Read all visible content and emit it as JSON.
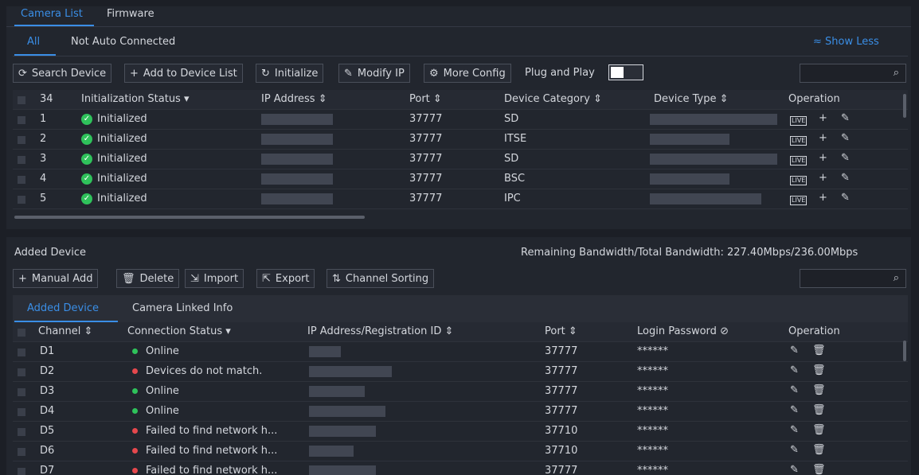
{
  "top_tabs": [
    "Camera List",
    "Firmware"
  ],
  "sub_tabs": [
    "All",
    "Not Auto Connected"
  ],
  "show_less": "Show Less",
  "toolbar": {
    "search_device": "Search Device",
    "add_to_list": "Add to Device List",
    "initialize": "Initialize",
    "modify_ip": "Modify IP",
    "more_config": "More Config",
    "plug_and_play": "Plug and Play"
  },
  "device_table": {
    "count": "34",
    "headers": [
      "Initialization Status",
      "IP Address",
      "Port",
      "Device Category",
      "Device Type",
      "Operation"
    ],
    "rows": [
      {
        "num": "1",
        "status": "Initialized",
        "port": "37777",
        "category": "SD"
      },
      {
        "num": "2",
        "status": "Initialized",
        "port": "37777",
        "category": "ITSE"
      },
      {
        "num": "3",
        "status": "Initialized",
        "port": "37777",
        "category": "SD"
      },
      {
        "num": "4",
        "status": "Initialized",
        "port": "37777",
        "category": "BSC"
      },
      {
        "num": "5",
        "status": "Initialized",
        "port": "37777",
        "category": "IPC"
      }
    ]
  },
  "added": {
    "title": "Added Device",
    "bandwidth_label": "Remaining Bandwidth/Total Bandwidth:",
    "bandwidth_value": "227.40Mbps/236.00Mbps",
    "toolbar": {
      "manual_add": "Manual Add",
      "delete": "Delete",
      "import": "Import",
      "export": "Export",
      "channel_sorting": "Channel Sorting"
    },
    "tabs": [
      "Added Device",
      "Camera Linked Info"
    ],
    "headers": [
      "Channel",
      "Connection Status",
      "IP Address/Registration ID",
      "Port",
      "Login Password",
      "Operation"
    ],
    "rows": [
      {
        "channel": "D1",
        "status": "Online",
        "state": "ok",
        "port": "37777",
        "password": "******"
      },
      {
        "channel": "D2",
        "status": "Devices do not match.",
        "state": "err",
        "port": "37777",
        "password": "******"
      },
      {
        "channel": "D3",
        "status": "Online",
        "state": "ok",
        "port": "37777",
        "password": "******"
      },
      {
        "channel": "D4",
        "status": "Online",
        "state": "ok",
        "port": "37777",
        "password": "******"
      },
      {
        "channel": "D5",
        "status": "Failed to find network h...",
        "state": "err",
        "port": "37710",
        "password": "******"
      },
      {
        "channel": "D6",
        "status": "Failed to find network h...",
        "state": "err",
        "port": "37710",
        "password": "******"
      },
      {
        "channel": "D7",
        "status": "Failed to find network h...",
        "state": "err",
        "port": "37777",
        "password": "******"
      }
    ]
  },
  "colors": {
    "accent": "#3a8ee6",
    "online": "#2fc25b",
    "error": "#e5484d"
  },
  "icons": [
    "refresh-icon",
    "plus-icon",
    "initialize-icon",
    "edit-icon",
    "settings-icon",
    "search-icon",
    "sort-icon",
    "live-icon",
    "delete-icon",
    "import-icon",
    "export-icon",
    "eye-off-icon",
    "check-icon"
  ]
}
